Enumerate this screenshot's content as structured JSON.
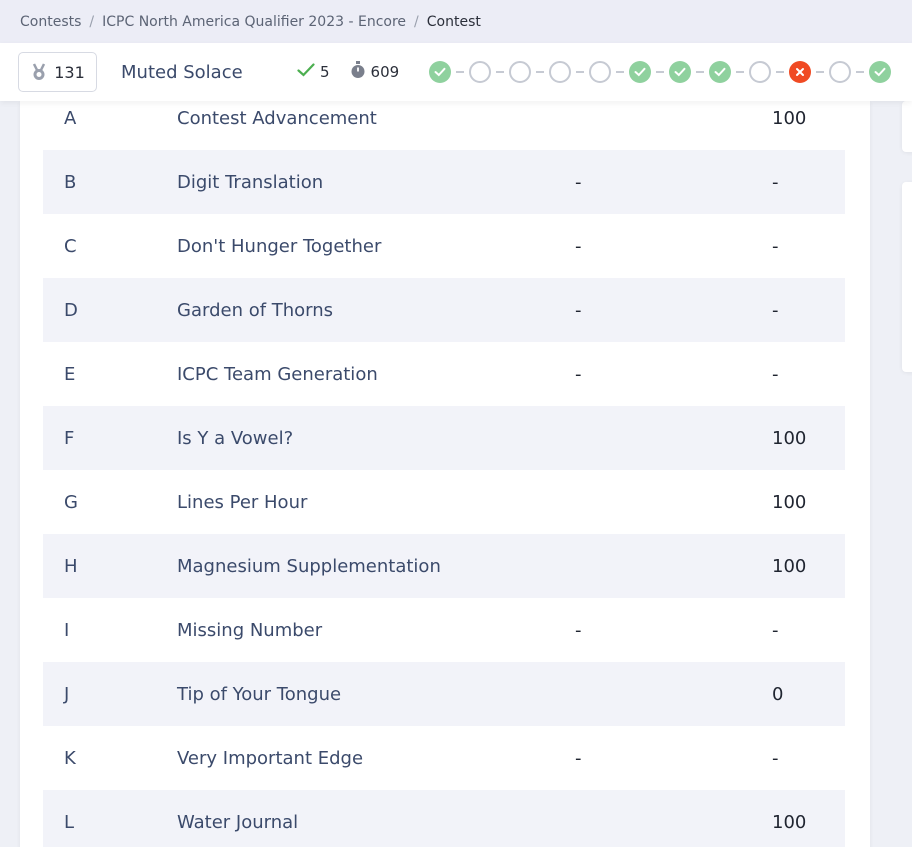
{
  "breadcrumb": {
    "items": [
      "Contests",
      "ICPC North America Qualifier 2023 - Encore"
    ],
    "separator": "/",
    "current": "Contest"
  },
  "status": {
    "medal_value": "131",
    "team_name": "Muted Solace",
    "solved_count": "5",
    "penalty": "609",
    "timeline": [
      "solved",
      "empty",
      "empty",
      "empty",
      "empty",
      "solved",
      "solved",
      "solved",
      "empty",
      "failed",
      "empty",
      "solved"
    ]
  },
  "colors": {
    "solved": "#8fd19e",
    "failed": "#f04a23",
    "stripe": "#f2f3f9",
    "text": "#3b4a6b"
  },
  "problems": [
    {
      "letter": "A",
      "name": "Contest Advancement",
      "attempt": "",
      "score": "100"
    },
    {
      "letter": "B",
      "name": "Digit Translation",
      "attempt": "-",
      "score": "-"
    },
    {
      "letter": "C",
      "name": "Don't Hunger Together",
      "attempt": "-",
      "score": "-"
    },
    {
      "letter": "D",
      "name": "Garden of Thorns",
      "attempt": "-",
      "score": "-"
    },
    {
      "letter": "E",
      "name": "ICPC Team Generation",
      "attempt": "-",
      "score": "-"
    },
    {
      "letter": "F",
      "name": "Is Y a Vowel?",
      "attempt": "",
      "score": "100"
    },
    {
      "letter": "G",
      "name": "Lines Per Hour",
      "attempt": "",
      "score": "100"
    },
    {
      "letter": "H",
      "name": "Magnesium Supplementation",
      "attempt": "",
      "score": "100"
    },
    {
      "letter": "I",
      "name": "Missing Number",
      "attempt": "-",
      "score": "-"
    },
    {
      "letter": "J",
      "name": "Tip of Your Tongue",
      "attempt": "",
      "score": "0"
    },
    {
      "letter": "K",
      "name": "Very Important Edge",
      "attempt": "-",
      "score": "-"
    },
    {
      "letter": "L",
      "name": "Water Journal",
      "attempt": "",
      "score": "100"
    }
  ]
}
